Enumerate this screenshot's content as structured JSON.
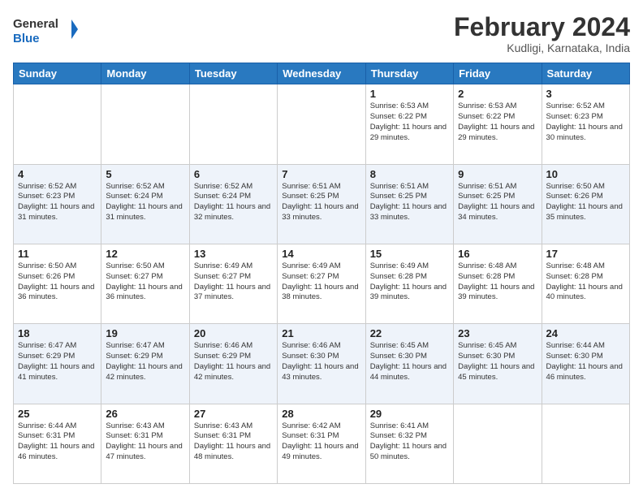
{
  "header": {
    "logo_line1": "General",
    "logo_line2": "Blue",
    "main_title": "February 2024",
    "subtitle": "Kudligi, Karnataka, India"
  },
  "days_of_week": [
    "Sunday",
    "Monday",
    "Tuesday",
    "Wednesday",
    "Thursday",
    "Friday",
    "Saturday"
  ],
  "weeks": [
    [
      {
        "day": "",
        "info": ""
      },
      {
        "day": "",
        "info": ""
      },
      {
        "day": "",
        "info": ""
      },
      {
        "day": "",
        "info": ""
      },
      {
        "day": "1",
        "info": "Sunrise: 6:53 AM\nSunset: 6:22 PM\nDaylight: 11 hours\nand 29 minutes."
      },
      {
        "day": "2",
        "info": "Sunrise: 6:53 AM\nSunset: 6:22 PM\nDaylight: 11 hours\nand 29 minutes."
      },
      {
        "day": "3",
        "info": "Sunrise: 6:52 AM\nSunset: 6:23 PM\nDaylight: 11 hours\nand 30 minutes."
      }
    ],
    [
      {
        "day": "4",
        "info": "Sunrise: 6:52 AM\nSunset: 6:23 PM\nDaylight: 11 hours\nand 31 minutes."
      },
      {
        "day": "5",
        "info": "Sunrise: 6:52 AM\nSunset: 6:24 PM\nDaylight: 11 hours\nand 31 minutes."
      },
      {
        "day": "6",
        "info": "Sunrise: 6:52 AM\nSunset: 6:24 PM\nDaylight: 11 hours\nand 32 minutes."
      },
      {
        "day": "7",
        "info": "Sunrise: 6:51 AM\nSunset: 6:25 PM\nDaylight: 11 hours\nand 33 minutes."
      },
      {
        "day": "8",
        "info": "Sunrise: 6:51 AM\nSunset: 6:25 PM\nDaylight: 11 hours\nand 33 minutes."
      },
      {
        "day": "9",
        "info": "Sunrise: 6:51 AM\nSunset: 6:25 PM\nDaylight: 11 hours\nand 34 minutes."
      },
      {
        "day": "10",
        "info": "Sunrise: 6:50 AM\nSunset: 6:26 PM\nDaylight: 11 hours\nand 35 minutes."
      }
    ],
    [
      {
        "day": "11",
        "info": "Sunrise: 6:50 AM\nSunset: 6:26 PM\nDaylight: 11 hours\nand 36 minutes."
      },
      {
        "day": "12",
        "info": "Sunrise: 6:50 AM\nSunset: 6:27 PM\nDaylight: 11 hours\nand 36 minutes."
      },
      {
        "day": "13",
        "info": "Sunrise: 6:49 AM\nSunset: 6:27 PM\nDaylight: 11 hours\nand 37 minutes."
      },
      {
        "day": "14",
        "info": "Sunrise: 6:49 AM\nSunset: 6:27 PM\nDaylight: 11 hours\nand 38 minutes."
      },
      {
        "day": "15",
        "info": "Sunrise: 6:49 AM\nSunset: 6:28 PM\nDaylight: 11 hours\nand 39 minutes."
      },
      {
        "day": "16",
        "info": "Sunrise: 6:48 AM\nSunset: 6:28 PM\nDaylight: 11 hours\nand 39 minutes."
      },
      {
        "day": "17",
        "info": "Sunrise: 6:48 AM\nSunset: 6:28 PM\nDaylight: 11 hours\nand 40 minutes."
      }
    ],
    [
      {
        "day": "18",
        "info": "Sunrise: 6:47 AM\nSunset: 6:29 PM\nDaylight: 11 hours\nand 41 minutes."
      },
      {
        "day": "19",
        "info": "Sunrise: 6:47 AM\nSunset: 6:29 PM\nDaylight: 11 hours\nand 42 minutes."
      },
      {
        "day": "20",
        "info": "Sunrise: 6:46 AM\nSunset: 6:29 PM\nDaylight: 11 hours\nand 42 minutes."
      },
      {
        "day": "21",
        "info": "Sunrise: 6:46 AM\nSunset: 6:30 PM\nDaylight: 11 hours\nand 43 minutes."
      },
      {
        "day": "22",
        "info": "Sunrise: 6:45 AM\nSunset: 6:30 PM\nDaylight: 11 hours\nand 44 minutes."
      },
      {
        "day": "23",
        "info": "Sunrise: 6:45 AM\nSunset: 6:30 PM\nDaylight: 11 hours\nand 45 minutes."
      },
      {
        "day": "24",
        "info": "Sunrise: 6:44 AM\nSunset: 6:30 PM\nDaylight: 11 hours\nand 46 minutes."
      }
    ],
    [
      {
        "day": "25",
        "info": "Sunrise: 6:44 AM\nSunset: 6:31 PM\nDaylight: 11 hours\nand 46 minutes."
      },
      {
        "day": "26",
        "info": "Sunrise: 6:43 AM\nSunset: 6:31 PM\nDaylight: 11 hours\nand 47 minutes."
      },
      {
        "day": "27",
        "info": "Sunrise: 6:43 AM\nSunset: 6:31 PM\nDaylight: 11 hours\nand 48 minutes."
      },
      {
        "day": "28",
        "info": "Sunrise: 6:42 AM\nSunset: 6:31 PM\nDaylight: 11 hours\nand 49 minutes."
      },
      {
        "day": "29",
        "info": "Sunrise: 6:41 AM\nSunset: 6:32 PM\nDaylight: 11 hours\nand 50 minutes."
      },
      {
        "day": "",
        "info": ""
      },
      {
        "day": "",
        "info": ""
      }
    ]
  ]
}
